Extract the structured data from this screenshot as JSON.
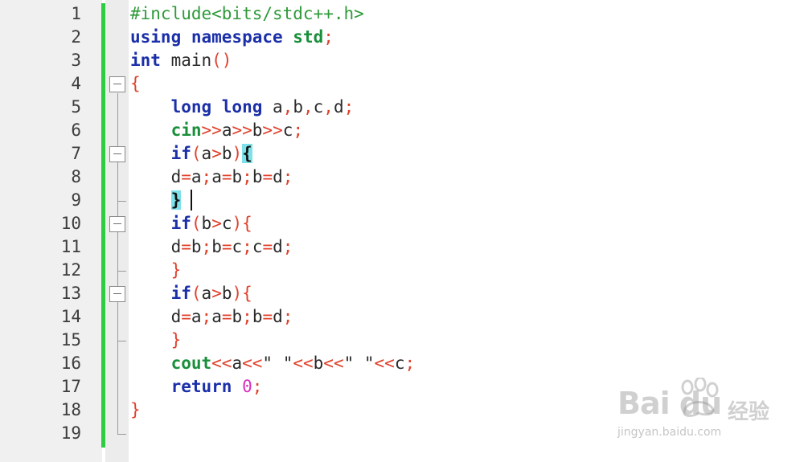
{
  "editor": {
    "lines": [
      {
        "num": "1",
        "segs": [
          {
            "t": "#include<bits/stdc++.h>",
            "c": "pp"
          }
        ]
      },
      {
        "num": "2",
        "segs": [
          {
            "t": "using namespace ",
            "c": "kw"
          },
          {
            "t": "std",
            "c": "fn"
          },
          {
            "t": ";",
            "c": "op"
          }
        ]
      },
      {
        "num": "3",
        "segs": [
          {
            "t": "int",
            "c": "ty"
          },
          {
            "t": " main",
            "c": "id"
          },
          {
            "t": "()",
            "c": "op"
          }
        ]
      },
      {
        "num": "4",
        "segs": [
          {
            "t": "{",
            "c": "op"
          }
        ]
      },
      {
        "num": "5",
        "segs": [
          {
            "t": "    ",
            "c": "id"
          },
          {
            "t": "long long",
            "c": "ty"
          },
          {
            "t": " a",
            "c": "id"
          },
          {
            "t": ",",
            "c": "op"
          },
          {
            "t": "b",
            "c": "id"
          },
          {
            "t": ",",
            "c": "op"
          },
          {
            "t": "c",
            "c": "id"
          },
          {
            "t": ",",
            "c": "op"
          },
          {
            "t": "d",
            "c": "id"
          },
          {
            "t": ";",
            "c": "op"
          }
        ]
      },
      {
        "num": "6",
        "segs": [
          {
            "t": "    ",
            "c": "id"
          },
          {
            "t": "cin",
            "c": "fn"
          },
          {
            "t": ">>",
            "c": "op"
          },
          {
            "t": "a",
            "c": "id"
          },
          {
            "t": ">>",
            "c": "op"
          },
          {
            "t": "b",
            "c": "id"
          },
          {
            "t": ">>",
            "c": "op"
          },
          {
            "t": "c",
            "c": "id"
          },
          {
            "t": ";",
            "c": "op"
          }
        ]
      },
      {
        "num": "7",
        "segs": [
          {
            "t": "    ",
            "c": "id"
          },
          {
            "t": "if",
            "c": "kw"
          },
          {
            "t": "(",
            "c": "op"
          },
          {
            "t": "a",
            "c": "id"
          },
          {
            "t": ">",
            "c": "op"
          },
          {
            "t": "b",
            "c": "id"
          },
          {
            "t": ")",
            "c": "op"
          },
          {
            "t": "{",
            "c": "hl"
          }
        ]
      },
      {
        "num": "8",
        "segs": [
          {
            "t": "    ",
            "c": "id"
          },
          {
            "t": "d",
            "c": "id"
          },
          {
            "t": "=",
            "c": "op"
          },
          {
            "t": "a",
            "c": "id"
          },
          {
            "t": ";",
            "c": "op"
          },
          {
            "t": "a",
            "c": "id"
          },
          {
            "t": "=",
            "c": "op"
          },
          {
            "t": "b",
            "c": "id"
          },
          {
            "t": ";",
            "c": "op"
          },
          {
            "t": "b",
            "c": "id"
          },
          {
            "t": "=",
            "c": "op"
          },
          {
            "t": "d",
            "c": "id"
          },
          {
            "t": ";",
            "c": "op"
          }
        ]
      },
      {
        "num": "9",
        "segs": [
          {
            "t": "    ",
            "c": "id"
          },
          {
            "t": "}",
            "c": "hl"
          }
        ]
      },
      {
        "num": "10",
        "segs": [
          {
            "t": "    ",
            "c": "id"
          },
          {
            "t": "if",
            "c": "kw"
          },
          {
            "t": "(",
            "c": "op"
          },
          {
            "t": "b",
            "c": "id"
          },
          {
            "t": ">",
            "c": "op"
          },
          {
            "t": "c",
            "c": "id"
          },
          {
            "t": "){",
            "c": "op"
          }
        ]
      },
      {
        "num": "11",
        "segs": [
          {
            "t": "    ",
            "c": "id"
          },
          {
            "t": "d",
            "c": "id"
          },
          {
            "t": "=",
            "c": "op"
          },
          {
            "t": "b",
            "c": "id"
          },
          {
            "t": ";",
            "c": "op"
          },
          {
            "t": "b",
            "c": "id"
          },
          {
            "t": "=",
            "c": "op"
          },
          {
            "t": "c",
            "c": "id"
          },
          {
            "t": ";",
            "c": "op"
          },
          {
            "t": "c",
            "c": "id"
          },
          {
            "t": "=",
            "c": "op"
          },
          {
            "t": "d",
            "c": "id"
          },
          {
            "t": ";",
            "c": "op"
          }
        ]
      },
      {
        "num": "12",
        "segs": [
          {
            "t": "    ",
            "c": "id"
          },
          {
            "t": "}",
            "c": "op"
          }
        ]
      },
      {
        "num": "13",
        "segs": [
          {
            "t": "    ",
            "c": "id"
          },
          {
            "t": "if",
            "c": "kw"
          },
          {
            "t": "(",
            "c": "op"
          },
          {
            "t": "a",
            "c": "id"
          },
          {
            "t": ">",
            "c": "op"
          },
          {
            "t": "b",
            "c": "id"
          },
          {
            "t": "){",
            "c": "op"
          }
        ]
      },
      {
        "num": "14",
        "segs": [
          {
            "t": "    ",
            "c": "id"
          },
          {
            "t": "d",
            "c": "id"
          },
          {
            "t": "=",
            "c": "op"
          },
          {
            "t": "a",
            "c": "id"
          },
          {
            "t": ";",
            "c": "op"
          },
          {
            "t": "a",
            "c": "id"
          },
          {
            "t": "=",
            "c": "op"
          },
          {
            "t": "b",
            "c": "id"
          },
          {
            "t": ";",
            "c": "op"
          },
          {
            "t": "b",
            "c": "id"
          },
          {
            "t": "=",
            "c": "op"
          },
          {
            "t": "d",
            "c": "id"
          },
          {
            "t": ";",
            "c": "op"
          }
        ]
      },
      {
        "num": "15",
        "segs": [
          {
            "t": "    ",
            "c": "id"
          },
          {
            "t": "}",
            "c": "op"
          }
        ]
      },
      {
        "num": "16",
        "segs": [
          {
            "t": "    ",
            "c": "id"
          },
          {
            "t": "cout",
            "c": "fn"
          },
          {
            "t": "<<",
            "c": "op"
          },
          {
            "t": "a",
            "c": "id"
          },
          {
            "t": "<<",
            "c": "op"
          },
          {
            "t": "\" \"",
            "c": "id"
          },
          {
            "t": "<<",
            "c": "op"
          },
          {
            "t": "b",
            "c": "id"
          },
          {
            "t": "<<",
            "c": "op"
          },
          {
            "t": "\" \"",
            "c": "id"
          },
          {
            "t": "<<",
            "c": "op"
          },
          {
            "t": "c",
            "c": "id"
          },
          {
            "t": ";",
            "c": "op"
          }
        ]
      },
      {
        "num": "17",
        "segs": [
          {
            "t": "    ",
            "c": "id"
          },
          {
            "t": "return",
            "c": "kw"
          },
          {
            "t": " ",
            "c": "id"
          },
          {
            "t": "0",
            "c": "num"
          },
          {
            "t": ";",
            "c": "op"
          }
        ]
      },
      {
        "num": "18",
        "segs": [
          {
            "t": "}",
            "c": "op"
          }
        ]
      },
      {
        "num": "19",
        "segs": []
      }
    ]
  },
  "colors": {
    "change_bar": "#2ecc40",
    "keyword": "#1b2fa8",
    "stream": "#1a8f3a",
    "operator": "#e0402a",
    "number": "#d92fbf",
    "bracket_highlight": "#7ee0e8"
  },
  "watermark": {
    "brand": "Bai du",
    "cn": "经验",
    "url": "jingyan.baidu.com",
    "icon": "paw-icon"
  }
}
